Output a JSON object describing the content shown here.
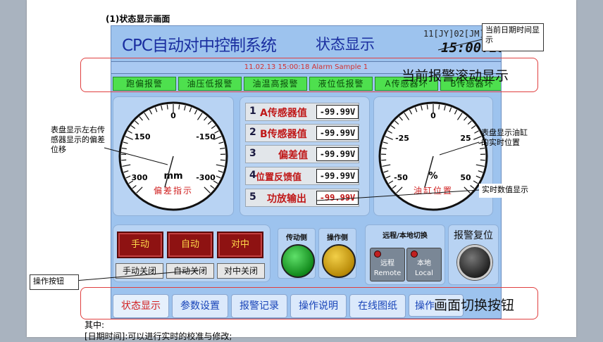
{
  "doc": {
    "heading": "(1)状态显示画面",
    "footer_1": "其中:",
    "footer_2": "[日期时间]:可以进行实时的校准与修改;"
  },
  "hmi": {
    "title": "CPC自动对中控制系统",
    "mode": "状态显示",
    "date": "11[JY]02[JM]",
    "time": "15:00:18",
    "alarm_marquee": "11.02.13 15:00:18  Alarm Sample 1",
    "alarms": [
      "跑偏报警",
      "油压低报警",
      "油温高报警",
      "液位低报警",
      "A传感器坏",
      "B传感器坏"
    ],
    "left_gauge": {
      "ticks": [
        "0",
        "150",
        "-150",
        "300",
        "-300"
      ],
      "unit": "mm",
      "label": "偏差指示"
    },
    "right_gauge": {
      "ticks": [
        "0",
        "-25",
        "25",
        "-50",
        "50"
      ],
      "unit": "%",
      "label": "油缸位置"
    },
    "values": [
      {
        "num": "1",
        "label": "A传感器值",
        "value": "-99.99V"
      },
      {
        "num": "2",
        "label": "B传感器值",
        "value": "-99.99V"
      },
      {
        "num": "3",
        "label": "偏差值",
        "value": "-99.99V"
      },
      {
        "num": "4",
        "label": "位置反馈值",
        "value": "-99.99V"
      },
      {
        "num": "5",
        "label": "功放输出",
        "value": "-99.99V"
      }
    ],
    "controls": {
      "manual": "手动",
      "auto": "自动",
      "center": "对中",
      "manual_off": "手动关闭",
      "auto_off": "自动关闭",
      "center_off": "对中关闭"
    },
    "lamps": {
      "drive_side": "传动侧",
      "operate_side": "操作侧"
    },
    "remote_local": {
      "title": "远程/本地切换",
      "remote_cn": "远程",
      "remote_en": "Remote",
      "local_cn": "本地",
      "local_en": "Local"
    },
    "alarm_reset": "报警复位",
    "tabs": [
      "状态显示",
      "参数设置",
      "报警记录",
      "操作说明",
      "在线图纸",
      "操作"
    ]
  },
  "annotations": {
    "datetime": "当前日期时间显示",
    "alarm_scroll": "当前报警滚动显示",
    "left_gauge": "表盘显示左右传感器显示的偏差位移",
    "right_gauge": "表盘显示油缸的实时位置",
    "realtime_values": "实时数值显示",
    "operation_buttons": "操作按钮",
    "screen_switch": "画面切换按钮"
  },
  "colors": {
    "hmi_bg": "#9dc3ee",
    "title_blue": "#1a2ea0",
    "alarm_green": "#4ee04e",
    "control_red": "#8e1212",
    "lamp_green": "#1fae2a",
    "lamp_yellow": "#c9a010",
    "annotation_red": "#e04040"
  }
}
